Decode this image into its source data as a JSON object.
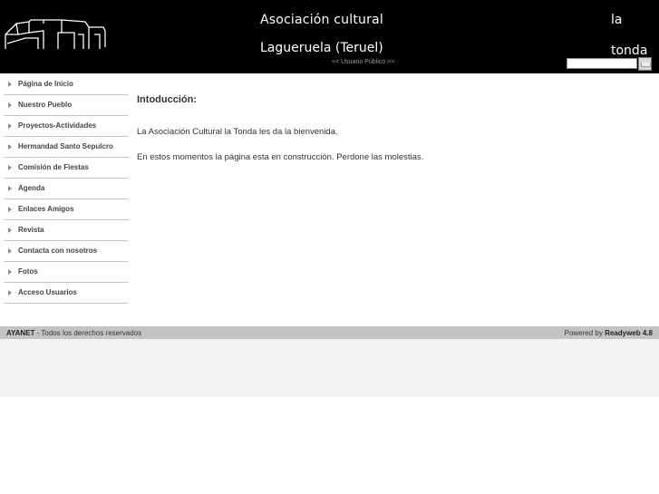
{
  "header": {
    "title_line1": "Asociación cultural",
    "title_line2": "Lagueruela (Teruel)",
    "user_status": "<< Usuario Público >>",
    "brand_word1": "la",
    "brand_word2": "tonda",
    "search": {
      "value": ""
    }
  },
  "sidebar": {
    "items": [
      {
        "label": "Página de Inicio"
      },
      {
        "label": "Nuestro Pueblo"
      },
      {
        "label": "Proyectos-Actividades"
      },
      {
        "label": "Hermandad Santo Sepulcro"
      },
      {
        "label": "Comisión de Fiestas"
      },
      {
        "label": "Agenda"
      },
      {
        "label": "Enlaces Amigos"
      },
      {
        "label": "Revista"
      },
      {
        "label": "Contacta con nosotros"
      },
      {
        "label": "Fotos"
      },
      {
        "label": "Acceso Usuarios"
      }
    ]
  },
  "main": {
    "heading": "Intoducción:",
    "paragraph1": "La Asociación Cultural la Tonda les da la bienvenida.",
    "paragraph2": "En estos momentos la página esta en construcción. Perdone las molestias."
  },
  "footer": {
    "company": "AYANET",
    "rights": " - Todos los derechos reservados",
    "powered_prefix": "Powered by ",
    "powered_product": "Readyweb 4.8"
  }
}
